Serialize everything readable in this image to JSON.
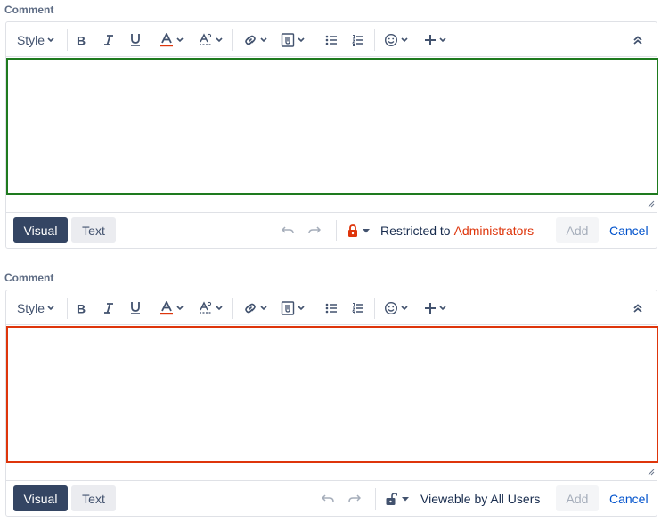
{
  "editors": [
    {
      "label": "Comment",
      "toolbar": {
        "style_label": "Style"
      },
      "mode": {
        "visual_label": "Visual",
        "text_label": "Text"
      },
      "restriction": {
        "prefix": "Restricted to",
        "target": "Administrators",
        "icon": "lock-icon",
        "color": "#de350b"
      },
      "actions": {
        "add_label": "Add",
        "cancel_label": "Cancel"
      },
      "border_color": "#1e7a1e"
    },
    {
      "label": "Comment",
      "toolbar": {
        "style_label": "Style"
      },
      "mode": {
        "visual_label": "Visual",
        "text_label": "Text"
      },
      "restriction": {
        "prefix": "Viewable by All Users",
        "target": "",
        "icon": "unlock-icon",
        "color": "#42526e"
      },
      "actions": {
        "add_label": "Add",
        "cancel_label": "Cancel"
      },
      "border_color": "#de350b"
    }
  ]
}
